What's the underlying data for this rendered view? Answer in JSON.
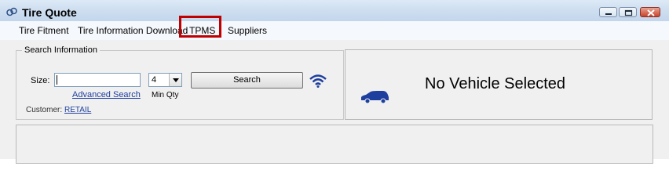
{
  "window": {
    "title": "Tire Quote",
    "icon": "tire-quote-icon"
  },
  "menu": {
    "items": [
      "Tire Fitment",
      "Tire Information Download",
      "TPMS",
      "Suppliers"
    ],
    "highlighted": "TPMS",
    "highlight_color": "#c00000"
  },
  "search": {
    "group_title": "Search Information",
    "size_label": "Size:",
    "size_value": "",
    "qty_value": "4",
    "min_qty_label": "Min Qty",
    "search_button": "Search",
    "advanced_link": "Advanced Search",
    "customer_label": "Customer:",
    "customer_value": "RETAIL",
    "wifi_color": "#1f3f9f"
  },
  "vehicle": {
    "status": "No Vehicle Selected",
    "car_color": "#1f3f9f"
  }
}
